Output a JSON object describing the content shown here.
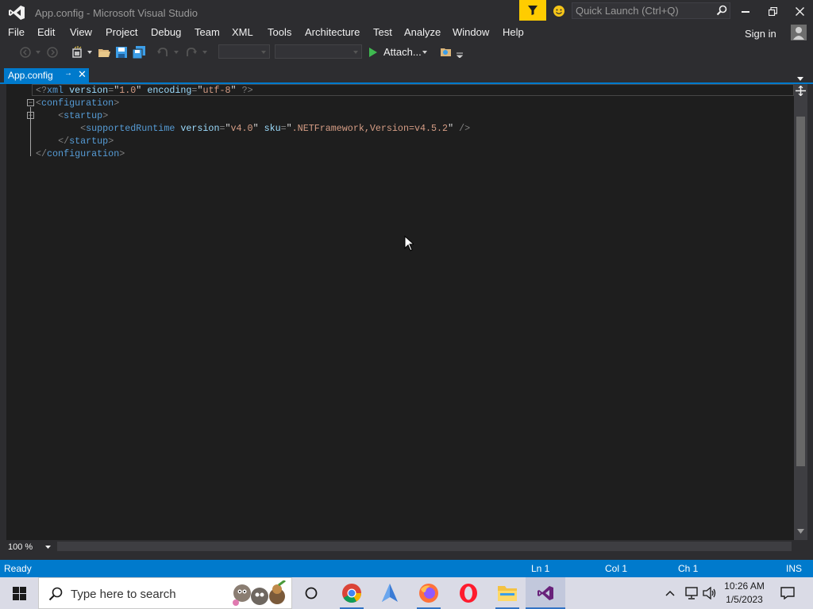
{
  "window": {
    "title": "App.config - Microsoft Visual Studio",
    "quick_launch_placeholder": "Quick Launch (Ctrl+Q)"
  },
  "menu": [
    "File",
    "Edit",
    "View",
    "Project",
    "Debug",
    "Team",
    "XML",
    "Tools",
    "Architecture",
    "Test",
    "Analyze",
    "Window",
    "Help"
  ],
  "account": {
    "signin_label": "Sign in"
  },
  "toolbar": {
    "attach_label": "Attach..."
  },
  "tab": {
    "label": "App.config",
    "pin_glyph": "→",
    "close_glyph": "✕"
  },
  "code": {
    "lines": [
      [
        [
          "pun",
          "<?"
        ],
        [
          "kw",
          "xml"
        ],
        [
          "txt",
          " "
        ],
        [
          "attr",
          "version"
        ],
        [
          "pun",
          "="
        ],
        [
          "txt",
          "\""
        ],
        [
          "val",
          "1.0"
        ],
        [
          "txt",
          "\""
        ],
        [
          "txt",
          " "
        ],
        [
          "attr",
          "encoding"
        ],
        [
          "pun",
          "="
        ],
        [
          "txt",
          "\""
        ],
        [
          "val",
          "utf-8"
        ],
        [
          "txt",
          "\""
        ],
        [
          "txt",
          " "
        ],
        [
          "pun",
          "?>"
        ]
      ],
      [
        [
          "pun",
          "<"
        ],
        [
          "kw",
          "configuration"
        ],
        [
          "pun",
          ">"
        ]
      ],
      [
        [
          "txt",
          "    "
        ],
        [
          "pun",
          "<"
        ],
        [
          "kw",
          "startup"
        ],
        [
          "pun",
          ">"
        ]
      ],
      [
        [
          "txt",
          "        "
        ],
        [
          "pun",
          "<"
        ],
        [
          "kw",
          "supportedRuntime"
        ],
        [
          "txt",
          " "
        ],
        [
          "attr",
          "version"
        ],
        [
          "pun",
          "="
        ],
        [
          "txt",
          "\""
        ],
        [
          "val",
          "v4.0"
        ],
        [
          "txt",
          "\""
        ],
        [
          "txt",
          " "
        ],
        [
          "attr",
          "sku"
        ],
        [
          "pun",
          "="
        ],
        [
          "txt",
          "\""
        ],
        [
          "val",
          ".NETFramework,Version=v4.5.2"
        ],
        [
          "txt",
          "\""
        ],
        [
          "txt",
          " "
        ],
        [
          "pun",
          "/>"
        ]
      ],
      [
        [
          "txt",
          "    "
        ],
        [
          "pun",
          "</"
        ],
        [
          "kw",
          "startup"
        ],
        [
          "pun",
          ">"
        ]
      ],
      [
        [
          "pun",
          "</"
        ],
        [
          "kw",
          "configuration"
        ],
        [
          "pun",
          ">"
        ]
      ]
    ]
  },
  "editor": {
    "zoom": "100 %"
  },
  "status": {
    "ready": "Ready",
    "line": "Ln 1",
    "col": "Col 1",
    "ch": "Ch 1",
    "mode": "INS"
  },
  "taskbar": {
    "search_placeholder": "Type here to search",
    "time": "10:26 AM",
    "date": "1/5/2023"
  },
  "colors": {
    "accent": "#007acc",
    "filter_button": "#ffcc00",
    "editor_bg": "#1e1e1e"
  }
}
